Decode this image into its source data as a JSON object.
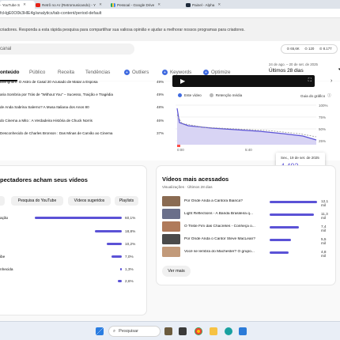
{
  "browser": {
    "tabs": [
      {
        "label": "- YouTube S"
      },
      {
        "label": "Retrô no Ar (Retromusicando) - Y"
      },
      {
        "label": "Pessoal - Google Drive"
      },
      {
        "label": "Painel - Alpha"
      }
    ],
    "url": "fcHgE0O0k3HlE4g/analytics/tab-content/period-default"
  },
  "banner": {
    "text": "criadores. Responda a esta rápida pesquisa para compartilhar sua valiosa opinião e ajudar a melhorar nossos programas para criadores."
  },
  "header": {
    "search_placeholder": "canal",
    "stats": [
      "65,6K",
      "120",
      "8.177"
    ]
  },
  "analytics_tabs": [
    {
      "label": "onteúdo",
      "active": true
    },
    {
      "label": "Público"
    },
    {
      "label": "Receita"
    },
    {
      "label": "Tendências"
    },
    {
      "label": "Outliers"
    },
    {
      "label": "Keywords"
    },
    {
      "label": "Optimize"
    }
  ],
  "period": {
    "range": "24 de ago. – 20 de set. de 2025",
    "label": "Últimos 28 dias"
  },
  "retention_rows": [
    {
      "title": "Billingham: O Astro de Casal 20 Acusado de Matar a Esposa",
      "pct": "49%"
    },
    {
      "title": "aria Sombria por Trás de \"Without You\" – Sucesso, Traição e Tragédia",
      "pct": "49%"
    },
    {
      "title": "de Anda Sabrina Salerno? A Musa Italiana dos Anos 80",
      "pct": "48%"
    },
    {
      "title": "do Cinema a Mito : A Verdadeira História de Chuck Norris",
      "pct": "46%"
    },
    {
      "title": "Desconhecido de Charles Bronson : Das Minas de Carvão ao Cinema",
      "pct": "37%"
    }
  ],
  "retention_chart": {
    "legend": [
      "Este vídeo",
      "Retenção média"
    ],
    "guide_label": "Guia do gráfico",
    "y_ticks": [
      "100%",
      "75%",
      "50%",
      "25%"
    ],
    "x_ticks": [
      "0:00",
      "5:40"
    ]
  },
  "tooltip": {
    "date": "Sex., 19 de set. de 2025",
    "value": "4.493"
  },
  "sources_card": {
    "title": "pectadores acham seus vídeos",
    "chips": [
      "Pesquisa do YouTube",
      "Vídeos sugeridos",
      "Playlists"
    ],
    "rows": [
      {
        "label": "ação",
        "value": "60,1%",
        "pct": 60.1
      },
      {
        "label": "",
        "value": "18,8%",
        "pct": 18.8
      },
      {
        "label": "",
        "value": "10,2%",
        "pct": 10.2
      },
      {
        "label": "ibe",
        "value": "7,0%",
        "pct": 7.0
      },
      {
        "label": "nhecida",
        "value": "1,3%",
        "pct": 1.3
      },
      {
        "label": "",
        "value": "2,6%",
        "pct": 2.6
      }
    ]
  },
  "top_videos_card": {
    "title": "Vídeos mais acessados",
    "subtitle": "Visualizações · Últimos 28 dias",
    "items": [
      {
        "title": "Por Onde Anda a Cantora Bianca?",
        "value": "12,1 mil",
        "ratio": 1.0
      },
      {
        "title": "Light Reflections - A Banda Brasileira q...",
        "value": "11,3 mil",
        "ratio": 0.93
      },
      {
        "title": "O Triste Fim das Chacretes - Conheça o...",
        "value": "7,4 mil",
        "ratio": 0.61
      },
      {
        "title": "Por Onde Anda o Cantor Steve MacLean?",
        "value": "5,5 mil",
        "ratio": 0.45
      },
      {
        "title": "Você se lembra do Machester? O grupo...",
        "value": "4,8 mil",
        "ratio": 0.4
      }
    ],
    "more_label": "Ver mais"
  },
  "taskbar": {
    "search_placeholder": "Pesquisar"
  },
  "colors": {
    "accent": "#5b52d6",
    "link_blue": "#3f6ae0"
  }
}
